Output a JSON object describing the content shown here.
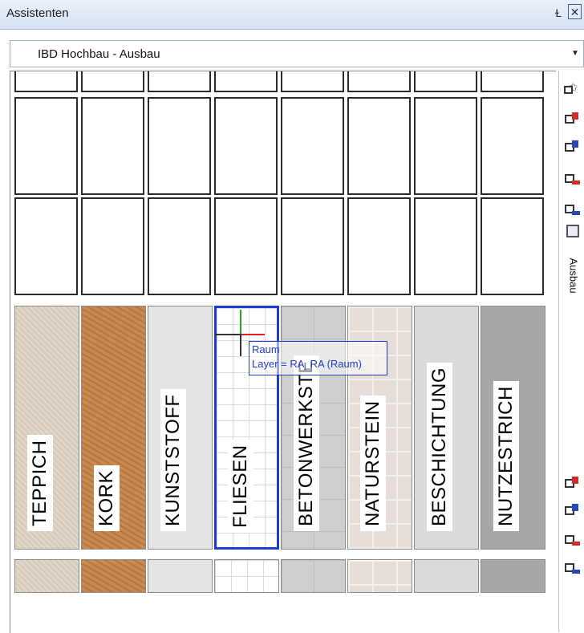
{
  "window": {
    "title": "Assistenten",
    "pin_glyph": "Ɫ",
    "close_glyph": "✕"
  },
  "dropdown": {
    "value": "IBD Hochbau - Ausbau",
    "arrow_glyph": "▼"
  },
  "materials": [
    {
      "label": "TEPPICH",
      "texture": "teppich"
    },
    {
      "label": "KORK",
      "texture": "kork"
    },
    {
      "label": "KUNSTSTOFF",
      "texture": "kunst"
    },
    {
      "label": "FLIESEN",
      "texture": "fliesen",
      "selected": true
    },
    {
      "label": "BETONWERKSTE",
      "texture": "beton"
    },
    {
      "label": "NATURSTEIN",
      "texture": "natur"
    },
    {
      "label": "BESCHICHTUNG",
      "texture": "besch"
    },
    {
      "label": "NUTZESTRICH",
      "texture": "nutz"
    }
  ],
  "tooltip": {
    "line1": "Raum",
    "line2": "Layer = RA_RA (Raum)"
  },
  "sidebar": {
    "tab_label": "Ausbau",
    "top_icons": [
      "favorites-star-icon",
      "red-flag-icon",
      "blue-flag-icon",
      "red-shadow-icon",
      "blue-shadow-icon"
    ],
    "bottom_icons": [
      "red-flag-icon",
      "blue-flag-icon",
      "red-shadow-icon",
      "blue-shadow-icon"
    ]
  }
}
